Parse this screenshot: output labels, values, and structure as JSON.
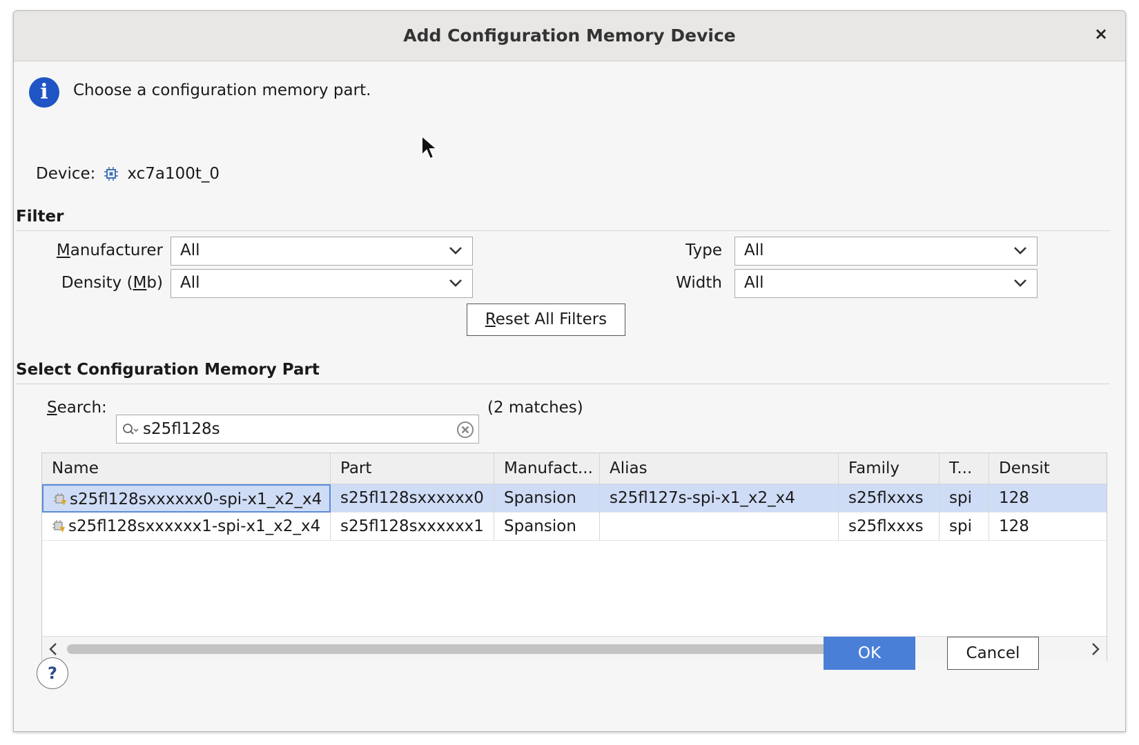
{
  "dialog": {
    "title": "Add Configuration Memory Device",
    "close_glyph": "×",
    "message": "Choose a configuration memory part.",
    "device_label": "Device:",
    "device_value": "xc7a100t_0"
  },
  "filter": {
    "section_title": "Filter",
    "manufacturer": {
      "label_pre": "",
      "label_u": "M",
      "label_post": "anufacturer",
      "value": "All"
    },
    "density": {
      "label_pre": "Density (",
      "label_u": "M",
      "label_post": "b)",
      "value": "All"
    },
    "type": {
      "label": "Type",
      "value": "All"
    },
    "width": {
      "label": "Width",
      "value": "All"
    },
    "reset_u": "R",
    "reset_rest": "eset All Filters"
  },
  "select": {
    "section_title": "Select Configuration Memory Part",
    "search_label_u": "S",
    "search_label_rest": "earch:",
    "search_value": "s25fl128s",
    "matches": "(2 matches)"
  },
  "table": {
    "columns": [
      "Name",
      "Part",
      "Manufact...",
      "Alias",
      "Family",
      "T...",
      "Densit"
    ],
    "rows": [
      {
        "name": "s25fl128sxxxxxx0-spi-x1_x2_x4",
        "part": "s25fl128sxxxxxx0",
        "manufacturer": "Spansion",
        "alias": "s25fl127s-spi-x1_x2_x4",
        "family": "s25flxxxs",
        "type": "spi",
        "density": "128",
        "selected": true
      },
      {
        "name": "s25fl128sxxxxxx1-spi-x1_x2_x4",
        "part": "s25fl128sxxxxxx1",
        "manufacturer": "Spansion",
        "alias": "",
        "family": "s25flxxxs",
        "type": "spi",
        "density": "128",
        "selected": false
      }
    ]
  },
  "footer": {
    "help_glyph": "?",
    "ok_label": "OK",
    "cancel_label": "Cancel"
  },
  "icons": {
    "info": "info-icon",
    "chip": "chip-icon",
    "search": "search-icon",
    "clear": "clear-icon",
    "part": "memory-part-icon"
  },
  "colors": {
    "accent": "#4a7fd8",
    "selection": "#cfdcf6",
    "info": "#1f55c4"
  }
}
